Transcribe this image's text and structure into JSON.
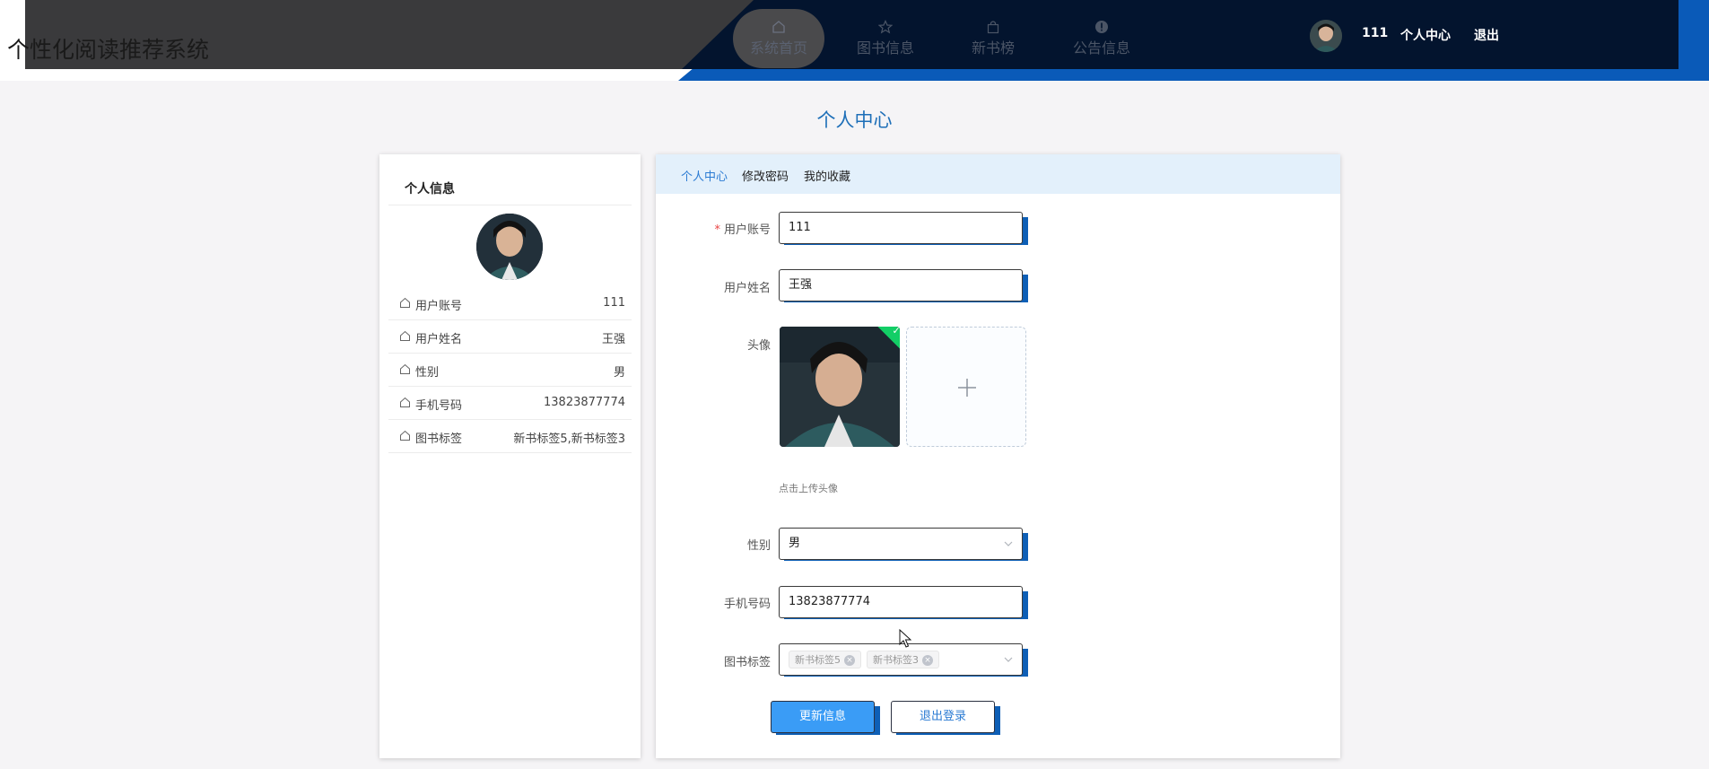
{
  "header": {
    "site_title": "个性化阅读推荐系统",
    "nav": [
      {
        "label": "系统首页",
        "icon": "home-icon",
        "active": true
      },
      {
        "label": "图书信息",
        "icon": "star-icon",
        "active": false
      },
      {
        "label": "新书榜",
        "icon": "bag-icon",
        "active": false
      },
      {
        "label": "公告信息",
        "icon": "info-icon",
        "active": false
      }
    ],
    "username": "111",
    "user_center_label": "个人中心",
    "logout_label": "退出"
  },
  "page_title": "个人中心",
  "profile_card": {
    "title": "个人信息",
    "rows": [
      {
        "label": "用户账号",
        "value": "111"
      },
      {
        "label": "用户姓名",
        "value": "王强"
      },
      {
        "label": "性别",
        "value": "男"
      },
      {
        "label": "手机号码",
        "value": "13823877774"
      },
      {
        "label": "图书标签",
        "value": "新书标签5,新书标签3"
      }
    ]
  },
  "tabs": [
    "个人中心",
    "修改密码",
    "我的收藏"
  ],
  "form": {
    "required_mark": "*",
    "account_label": "用户账号",
    "account_value": "111",
    "name_label": "用户姓名",
    "name_value": "王强",
    "avatar_label": "头像",
    "avatar_hint": "点击上传头像",
    "gender_label": "性别",
    "gender_value": "男",
    "phone_label": "手机号码",
    "phone_value": "13823877774",
    "tags_label": "图书标签",
    "tags": [
      "新书标签5",
      "新书标签3"
    ],
    "update_button": "更新信息",
    "logout_button": "退出登录"
  },
  "colors": {
    "accent": "#2b7bd3",
    "header_dark": "#03142e",
    "header_blue": "#0a5ab8",
    "primary_button": "#3a9cf6",
    "tab_bar": "#e3f0fb"
  }
}
